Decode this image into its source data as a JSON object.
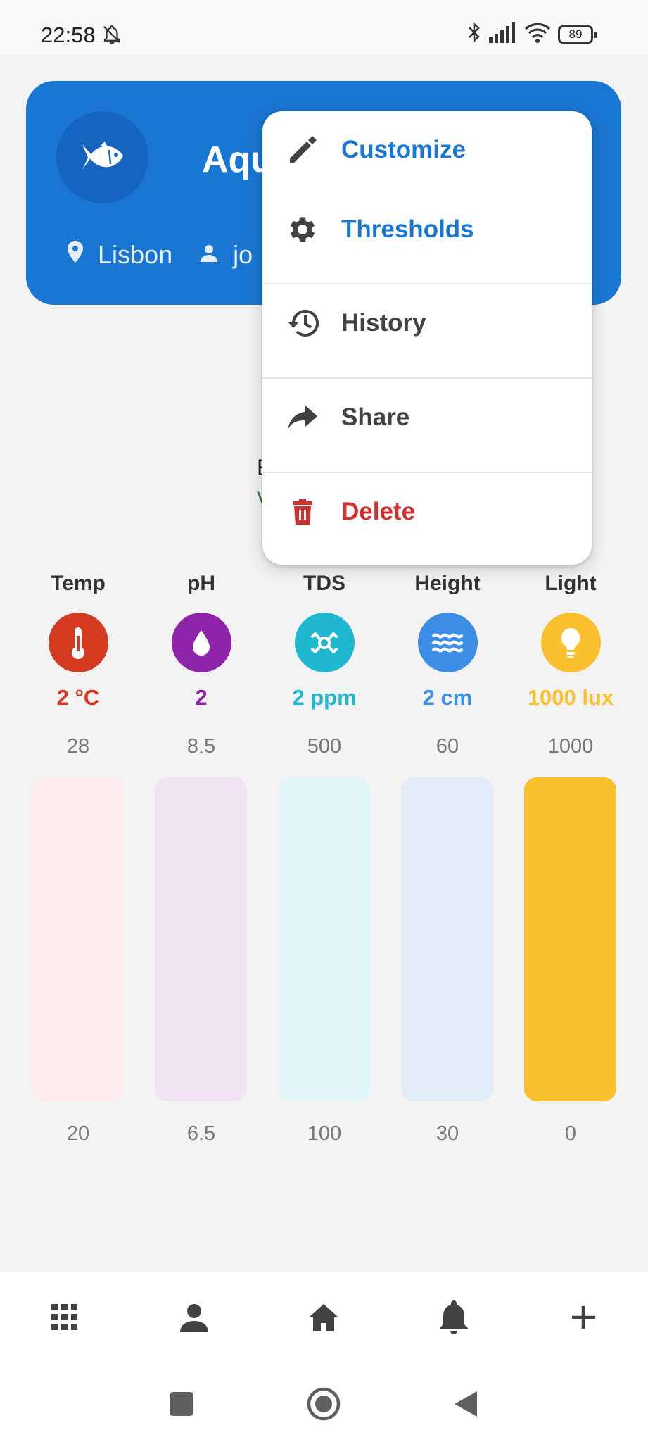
{
  "status_bar": {
    "time": "22:58",
    "battery": "89"
  },
  "header": {
    "title": "Aqu",
    "location": "Lisbon",
    "user": "jo"
  },
  "status_text": {
    "line1": "E",
    "line2": "V"
  },
  "menu": {
    "items": [
      {
        "label": "Customize",
        "icon": "pencil-icon",
        "color": "#1976d2"
      },
      {
        "label": "Thresholds",
        "icon": "gear-icon",
        "color": "#1976d2"
      },
      {
        "label": "History",
        "icon": "history-icon",
        "color": "#424242"
      },
      {
        "label": "Share",
        "icon": "share-icon",
        "color": "#424242"
      },
      {
        "label": "Delete",
        "icon": "trash-icon",
        "color": "#d32f2f"
      }
    ]
  },
  "sensors": [
    {
      "name": "Temp",
      "icon": "thermometer-icon",
      "value": "2 °C",
      "max": "28",
      "min": "20",
      "color": "#d33a1f",
      "track": "#ffebee",
      "fill": 0
    },
    {
      "name": "pH",
      "icon": "drop-icon",
      "value": "2",
      "max": "8.5",
      "min": "6.5",
      "color": "#8e24aa",
      "track": "#f1e3f4",
      "fill": 0
    },
    {
      "name": "TDS",
      "icon": "molecule-icon",
      "value": "2 ppm",
      "max": "500",
      "min": "100",
      "color": "#1fb8d0",
      "track": "#e0f6f9",
      "fill": 0
    },
    {
      "name": "Height",
      "icon": "waves-icon",
      "value": "2 cm",
      "max": "60",
      "min": "30",
      "color": "#3b8de6",
      "track": "#e2ecf8",
      "fill": 0
    },
    {
      "name": "Light",
      "icon": "bulb-icon",
      "value": "1000 lux",
      "max": "1000",
      "min": "0",
      "color": "#fbc02d",
      "track": "#fbc02d",
      "fill": 1
    }
  ],
  "bottom_nav": [
    {
      "icon": "apps-grid-icon"
    },
    {
      "icon": "person-icon"
    },
    {
      "icon": "home-icon"
    },
    {
      "icon": "bell-icon"
    },
    {
      "icon": "plus-icon"
    }
  ],
  "system_nav": [
    {
      "icon": "recents-square-icon"
    },
    {
      "icon": "home-circle-icon"
    },
    {
      "icon": "back-triangle-icon"
    }
  ]
}
